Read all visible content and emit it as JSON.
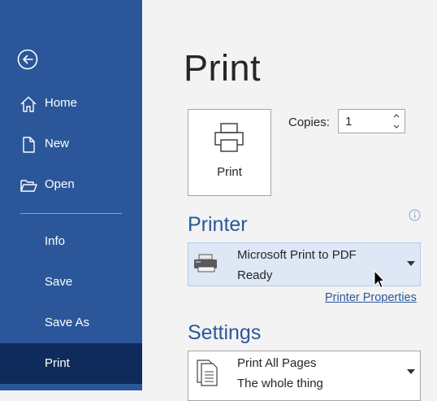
{
  "sidebar": {
    "back_label": "Back",
    "items": [
      {
        "label": "Home",
        "icon": "home-icon"
      },
      {
        "label": "New",
        "icon": "new-document-icon"
      },
      {
        "label": "Open",
        "icon": "folder-open-icon"
      },
      {
        "label": "Info"
      },
      {
        "label": "Save"
      },
      {
        "label": "Save As"
      },
      {
        "label": "Print",
        "active": true
      }
    ]
  },
  "main": {
    "title": "Print",
    "print_button_label": "Print",
    "copies": {
      "label": "Copies:",
      "value": "1"
    },
    "printer": {
      "heading": "Printer",
      "name": "Microsoft Print to PDF",
      "status": "Ready",
      "properties_link": "Printer Properties"
    },
    "settings": {
      "heading": "Settings",
      "pages_option": "Print All Pages",
      "pages_description": "The whole thing"
    }
  },
  "colors": {
    "sidebar_bg": "#2b579a",
    "sidebar_active": "#0f2b5b",
    "accent": "#2b579a",
    "printer_dropdown_bg": "#dde7f6"
  }
}
